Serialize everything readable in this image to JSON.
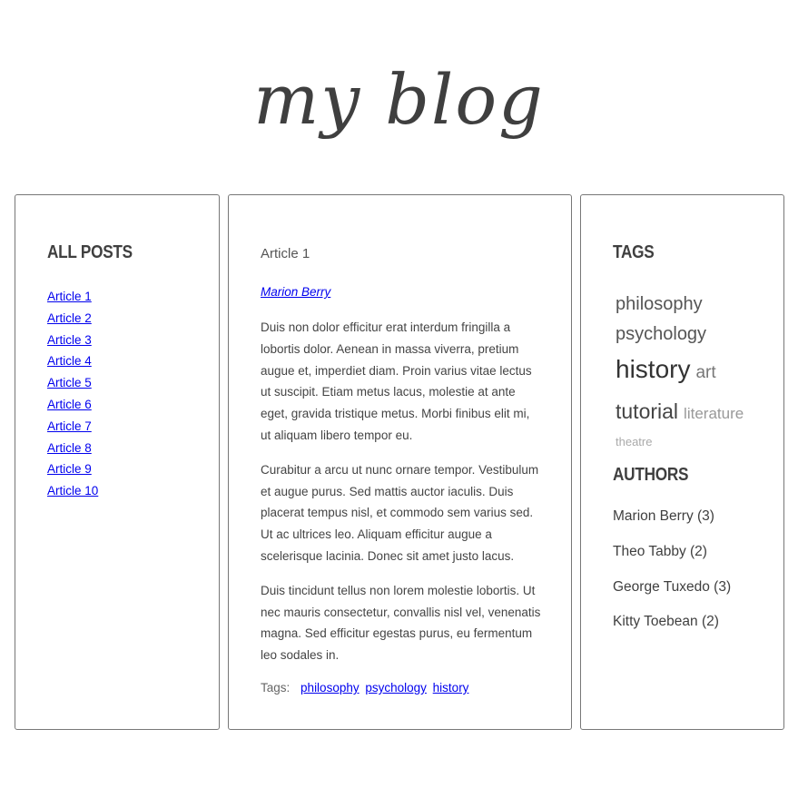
{
  "site": {
    "title": "my blog"
  },
  "left": {
    "heading": "ALL POSTS",
    "posts": [
      "Article 1",
      "Article 2",
      "Article 3",
      "Article 4",
      "Article 5",
      "Article 6",
      "Article 7",
      "Article 8",
      "Article 9",
      "Article 10"
    ]
  },
  "article": {
    "title": "Article 1",
    "author": "Marion Berry",
    "paragraphs": [
      "Duis non dolor efficitur erat interdum fringilla a lobortis dolor. Aenean in massa viverra, pretium augue et, imperdiet diam. Proin varius vitae lectus ut suscipit. Etiam metus lacus, molestie at ante eget, gravida tristique metus. Morbi finibus elit mi, ut aliquam libero tempor eu.",
      "Curabitur a arcu ut nunc ornare tempor. Vestibulum et augue purus. Sed mattis auctor iaculis. Duis placerat tempus nisl, et commodo sem varius sed. Ut ac ultrices leo. Aliquam efficitur augue a scelerisque lacinia. Donec sit amet justo lacus.",
      "Duis tincidunt tellus non lorem molestie lobortis. Ut nec mauris consectetur, convallis nisl vel, venenatis magna. Sed efficitur egestas purus, eu fermentum leo sodales in."
    ],
    "tags_label": "Tags:",
    "tags": [
      "philosophy",
      "psychology",
      "history"
    ]
  },
  "right": {
    "tags_heading": "TAGS",
    "tag_cloud": [
      "philosophy",
      "psychology",
      "history",
      "art",
      "tutorial",
      "literature",
      "theatre"
    ],
    "authors_heading": "AUTHORS",
    "authors": [
      "Marion Berry (3)",
      "Theo Tabby (2)",
      "George Tuxedo (3)",
      "Kitty Toebean (2)"
    ]
  }
}
